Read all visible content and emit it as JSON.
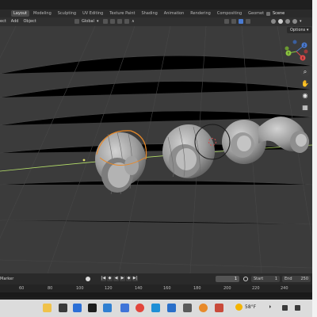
{
  "workspace_tabs": [
    "Layout",
    "Modeling",
    "Sculpting",
    "UV Editing",
    "Texture Paint",
    "Shading",
    "Animation",
    "Rendering",
    "Compositing",
    "Geomet"
  ],
  "active_tab": "Layout",
  "scene_label": "Scene",
  "header": {
    "menu": [
      "ect",
      "Add",
      "Object"
    ],
    "orientation": "Global"
  },
  "viewport": {
    "options_label": "Options",
    "gizmo": {
      "x_label": "X",
      "y_label": "Y",
      "z_label": "Z"
    }
  },
  "timeline": {
    "marker_label": "Marker",
    "current_frame": "1",
    "start_label": "Start",
    "start_value": "1",
    "end_label": "End",
    "end_value": "250",
    "ruler_ticks": [
      "60",
      "80",
      "100",
      "120",
      "140",
      "160",
      "180",
      "200",
      "220",
      "240"
    ]
  },
  "taskbar": {
    "weather": "58°F"
  },
  "colors": {
    "viewport_bg": "#3b3b3b",
    "selection_outline": "#e88a2a",
    "axis_x": "#e04a4a",
    "axis_y": "#8cc63f",
    "axis_z": "#4a7bd1"
  }
}
